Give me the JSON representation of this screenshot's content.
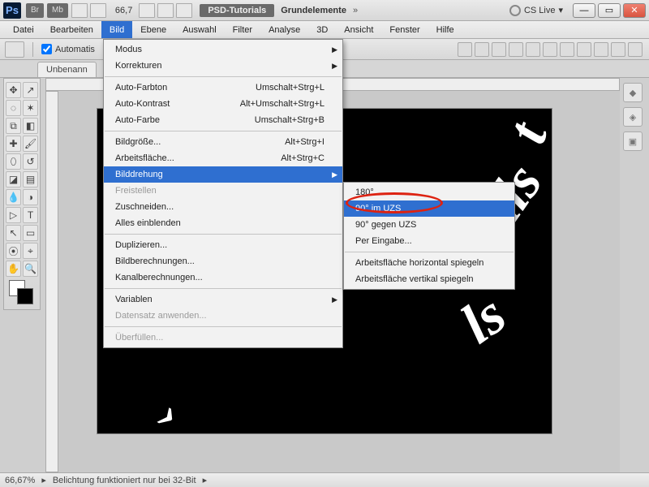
{
  "title": {
    "zoom": "66,7",
    "doc_badge": "PSD-Tutorials",
    "doc_name": "Grundelemente",
    "cslive": "CS Live"
  },
  "menubar": [
    "Datei",
    "Bearbeiten",
    "Bild",
    "Ebene",
    "Auswahl",
    "Filter",
    "Analyse",
    "3D",
    "Ansicht",
    "Fenster",
    "Hilfe"
  ],
  "menubar_active_index": 2,
  "optbar": {
    "checkbox_label": "Automatis"
  },
  "doctab": {
    "label": "Unbenann"
  },
  "status": {
    "zoom": "66,67%",
    "msg": "Belichtung funktioniert nur bei 32-Bit"
  },
  "menu_bild": {
    "groups": [
      [
        {
          "label": "Modus",
          "arrow": true
        },
        {
          "label": "Korrekturen",
          "arrow": true
        }
      ],
      [
        {
          "label": "Auto-Farbton",
          "shortcut": "Umschalt+Strg+L"
        },
        {
          "label": "Auto-Kontrast",
          "shortcut": "Alt+Umschalt+Strg+L"
        },
        {
          "label": "Auto-Farbe",
          "shortcut": "Umschalt+Strg+B"
        }
      ],
      [
        {
          "label": "Bildgröße...",
          "shortcut": "Alt+Strg+I"
        },
        {
          "label": "Arbeitsfläche...",
          "shortcut": "Alt+Strg+C"
        },
        {
          "label": "Bilddrehung",
          "arrow": true,
          "highlight": true
        },
        {
          "label": "Freistellen",
          "disabled": true
        },
        {
          "label": "Zuschneiden..."
        },
        {
          "label": "Alles einblenden"
        }
      ],
      [
        {
          "label": "Duplizieren..."
        },
        {
          "label": "Bildberechnungen..."
        },
        {
          "label": "Kanalberechnungen..."
        }
      ],
      [
        {
          "label": "Variablen",
          "arrow": true
        },
        {
          "label": "Datensatz anwenden...",
          "disabled": true
        }
      ],
      [
        {
          "label": "Überfüllen...",
          "disabled": true
        }
      ]
    ]
  },
  "menu_rot": {
    "groups": [
      [
        {
          "label": "180°"
        },
        {
          "label": "90° im UZS",
          "highlight": true
        },
        {
          "label": "90° gegen UZS"
        },
        {
          "label": "Per Eingabe..."
        }
      ],
      [
        {
          "label": "Arbeitsfläche horizontal spiegeln"
        },
        {
          "label": "Arbeitsfläche vertikal spiegeln"
        }
      ]
    ]
  }
}
